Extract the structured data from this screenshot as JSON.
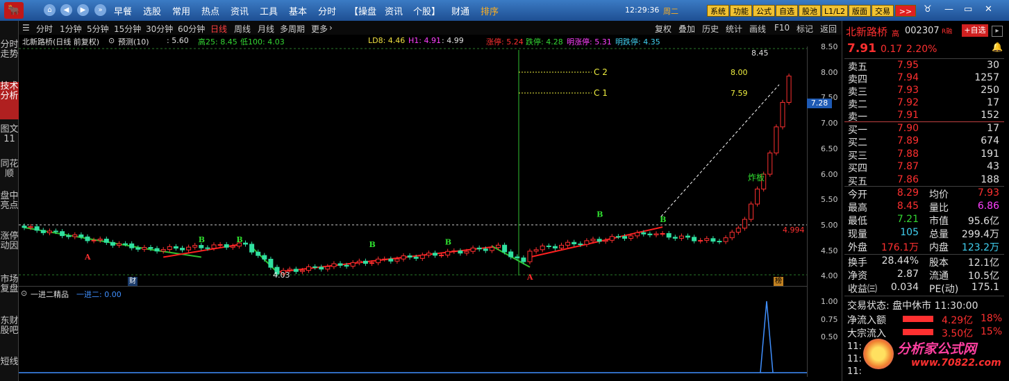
{
  "topbar": {
    "logo": "🐂",
    "menus": [
      "早餐",
      "选股",
      "常用",
      "热点",
      "资讯",
      "工具",
      "基本",
      "分时",
      "【操盘",
      "资讯",
      "个股】",
      "财通",
      "排序"
    ],
    "time": "12:29:36",
    "weekday": "周二",
    "sys_buttons": [
      "系统",
      "功能",
      "公式",
      "自选",
      "股池",
      "L1/L2",
      "版面",
      "交易"
    ],
    "more": ">>"
  },
  "leftbar": {
    "tabs": [
      "分时走势",
      "技术分析",
      "图文11",
      "同花顺",
      "盘中亮点",
      "涨停动因",
      "市场复盘",
      "东财股吧",
      "短线"
    ]
  },
  "toolbar": {
    "periods": [
      "分时",
      "1分钟",
      "5分钟",
      "15分钟",
      "30分钟",
      "60分钟",
      "日线",
      "周线",
      "月线",
      "多周期",
      "更多"
    ],
    "active_period": "日线",
    "actions": [
      "复权",
      "叠加",
      "历史",
      "统计",
      "画线",
      "F10",
      "标记",
      "返回"
    ]
  },
  "infobar": {
    "title": "北新路桥(日线 前复权)",
    "predict": "预测(10)",
    "v1": ": 5.60",
    "high": "高25: 8.45",
    "low": "低100: 4.03",
    "ld8": "LD8: 4.46",
    "h1": "H1: 4.91",
    "h1b": ": 4.99",
    "zt": "涨停: 5.24",
    "dt": "跌停: 4.28",
    "mzt": "明涨停: 5.31",
    "mdt": "明跌停: 4.35"
  },
  "chart": {
    "labels": {
      "c2": "C 2",
      "c2v": "8.00",
      "c1": "C 1",
      "c1v": "7.59",
      "top": "8.45",
      "bottom": "4.03",
      "ref": "4.994",
      "blast": "炸板",
      "cai": "财",
      "bang": "榜",
      "marker_b": "B",
      "marker_a": "A"
    }
  },
  "chart_data": {
    "type": "candlestick",
    "ylim": [
      3.95,
      8.6
    ],
    "yticks": [
      "8.50",
      "8.00",
      "7.50",
      "7.00",
      "6.50",
      "6.00",
      "5.50",
      "5.00",
      "4.50",
      "4.00"
    ],
    "current_price_tag": "7.28",
    "sub_title": "一进二精品",
    "sub_series": "一进二: 0.00",
    "sub_yticks": [
      "1.00",
      "0.75",
      "0.50"
    ]
  },
  "quote": {
    "name": "北新路桥",
    "tag": "高",
    "code": "002307",
    "rz": "R融",
    "add": "+自选",
    "price": "7.91",
    "change": "0.17",
    "pct": "2.20%",
    "asks": [
      {
        "label": "卖五",
        "price": "7.95",
        "vol": "30"
      },
      {
        "label": "卖四",
        "price": "7.94",
        "vol": "1257"
      },
      {
        "label": "卖三",
        "price": "7.93",
        "vol": "250"
      },
      {
        "label": "卖二",
        "price": "7.92",
        "vol": "17"
      },
      {
        "label": "卖一",
        "price": "7.91",
        "vol": "152"
      }
    ],
    "bids": [
      {
        "label": "买一",
        "price": "7.90",
        "vol": "17"
      },
      {
        "label": "买二",
        "price": "7.89",
        "vol": "674"
      },
      {
        "label": "买三",
        "price": "7.88",
        "vol": "191"
      },
      {
        "label": "买四",
        "price": "7.87",
        "vol": "43"
      },
      {
        "label": "买五",
        "price": "7.86",
        "vol": "188"
      }
    ],
    "stats": [
      {
        "k1": "今开",
        "v1": "8.29",
        "k2": "均价",
        "v2": "7.93"
      },
      {
        "k1": "最高",
        "v1": "8.45",
        "k2": "量比",
        "v2": "6.86"
      },
      {
        "k1": "最低",
        "v1": "7.21",
        "k2": "市值",
        "v2": "95.6亿"
      },
      {
        "k1": "现量",
        "v1": "105",
        "k2": "总量",
        "v2": "299.4万"
      },
      {
        "k1": "外盘",
        "v1": "176.1万",
        "k2": "内盘",
        "v2": "123.2万"
      }
    ],
    "stats2": [
      {
        "k1": "换手",
        "v1": "28.44%",
        "k2": "股本",
        "v2": "12.1亿"
      },
      {
        "k1": "净资",
        "v1": "2.87",
        "k2": "流通",
        "v2": "10.5亿"
      },
      {
        "k1": "收益㈢",
        "v1": "0.034",
        "k2": "PE(动)",
        "v2": "175.1"
      }
    ],
    "status": "交易状态: 盘中休市 11:30:00",
    "flow1_label": "净流入额",
    "flow1_val": "4.29亿",
    "flow1_pct": "18%",
    "flow2_label": "大宗流入",
    "flow2_val": "3.50亿",
    "flow2_pct": "15%",
    "watermark": "分析家公式网",
    "watermark_url": "www.70822.com"
  }
}
